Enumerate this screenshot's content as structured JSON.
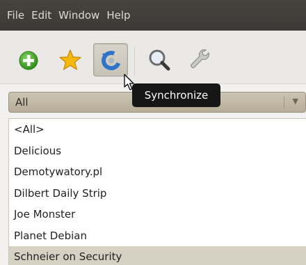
{
  "menubar": {
    "items": [
      {
        "label": "File"
      },
      {
        "label": "Edit"
      },
      {
        "label": "Window"
      },
      {
        "label": "Help"
      }
    ]
  },
  "toolbar": {
    "buttons": [
      {
        "icon": "add-icon",
        "color": "#3aa024"
      },
      {
        "icon": "star-icon",
        "color": "#f5b80c"
      },
      {
        "icon": "synchronize-icon",
        "color": "#2f74c8",
        "pressed": true
      },
      {
        "icon": "search-icon"
      },
      {
        "icon": "wrench-icon"
      }
    ],
    "tooltip": "Synchronize"
  },
  "filter": {
    "selected": "All",
    "arrow": "▼"
  },
  "feeds": {
    "items": [
      {
        "label": "<All>"
      },
      {
        "label": "Delicious"
      },
      {
        "label": "Demotywatory.pl"
      },
      {
        "label": "Dilbert Daily Strip"
      },
      {
        "label": "Joe Monster"
      },
      {
        "label": "Planet Debian"
      },
      {
        "label": "Schneier on Security",
        "selected": true
      }
    ]
  }
}
